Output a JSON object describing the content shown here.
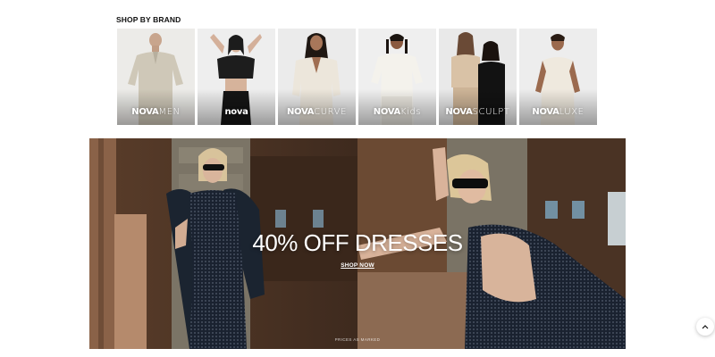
{
  "brands_section": {
    "title": "SHOP BY BRAND",
    "items": [
      {
        "logo_bold": "NOVA",
        "logo_thin": "MEN",
        "bg": "#e8e6e1",
        "outfit": "#cfc8b8"
      },
      {
        "logo_bold": "nova",
        "logo_thin": "",
        "bg": "#ececec",
        "outfit": "#1d1d1d"
      },
      {
        "logo_bold": "NOVA",
        "logo_thin": "CURVE",
        "bg": "#ebebeb",
        "outfit": "#e9e3d8"
      },
      {
        "logo_bold": "NOVA",
        "logo_thin": "Kids",
        "bg": "#eeeeee",
        "outfit": "#f2f0ea"
      },
      {
        "logo_bold": "NOVA",
        "logo_thin": "SCULPT",
        "bg": "#e9e9e9",
        "outfit": "#d9c2a6"
      },
      {
        "logo_bold": "NOVA",
        "logo_thin": "LUXE",
        "bg": "#ededed",
        "outfit": "#efe9de"
      }
    ]
  },
  "promo_banner": {
    "headline": "40% OFF DRESSES",
    "cta_label": "SHOP NOW",
    "note": "PRICES AS MARKED"
  },
  "scroll_top": {
    "icon": "chevron-up-icon"
  },
  "colors": {
    "banner_wood": "#4a3324",
    "dress": "#1a2230",
    "accent_white": "#ffffff"
  }
}
